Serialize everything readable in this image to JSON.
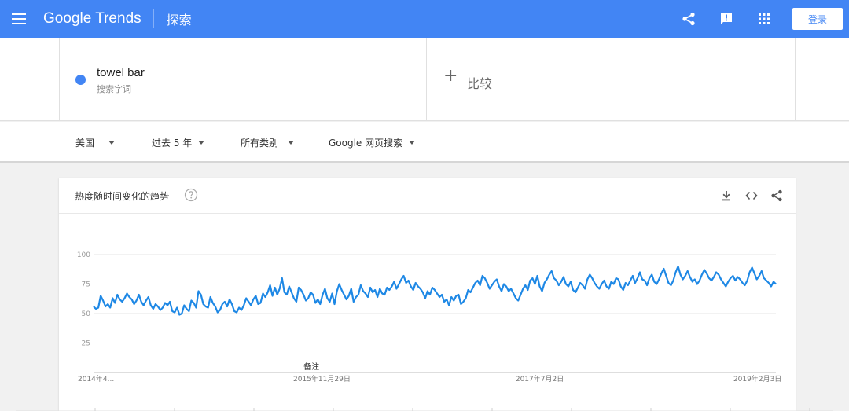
{
  "topbar": {
    "logo": "Google Trends",
    "page_title": "探索",
    "login_label": "登录",
    "icons": [
      "menu-icon",
      "share-icon",
      "feedback-icon",
      "apps-icon"
    ],
    "bg_color": "#4285f4"
  },
  "term": {
    "name": "towel bar",
    "type": "搜索字词",
    "dot_color": "#4285f4"
  },
  "compare": {
    "plus": "+",
    "label": "比较"
  },
  "filters": {
    "region": "美国",
    "time": "过去 5 年",
    "category": "所有类别",
    "property": "Google 网页搜索"
  },
  "card": {
    "title": "热度随时间变化的趋势",
    "icons": [
      "download-icon",
      "embed-icon",
      "share-icon",
      "help-icon"
    ]
  },
  "chart_data": {
    "type": "line",
    "title": "",
    "xlabel": "",
    "ylabel": "",
    "ylim": [
      0,
      100
    ],
    "yticks": [
      25,
      50,
      75,
      100
    ],
    "yticks_text": [
      "25",
      "50",
      "75",
      "100"
    ],
    "xticks": [
      {
        "label": "2014年4...",
        "x": 0
      },
      {
        "label": "2015年11月29日",
        "x": 87
      },
      {
        "label": "2017年7月2日",
        "x": 170
      },
      {
        "label": "2019年2月3日",
        "x": 253
      }
    ],
    "note_label": "备注",
    "note_x": 83,
    "series": [
      {
        "color": "#1e88e5",
        "values": [
          56,
          54,
          55,
          65,
          61,
          56,
          58,
          55,
          63,
          59,
          66,
          62,
          60,
          63,
          67,
          64,
          62,
          58,
          61,
          66,
          60,
          57,
          61,
          64,
          57,
          54,
          58,
          56,
          53,
          55,
          59,
          57,
          60,
          52,
          51,
          55,
          49,
          50,
          57,
          54,
          52,
          61,
          59,
          55,
          69,
          66,
          58,
          56,
          55,
          64,
          59,
          56,
          51,
          53,
          58,
          60,
          56,
          62,
          58,
          52,
          51,
          55,
          53,
          57,
          63,
          60,
          57,
          62,
          65,
          58,
          59,
          67,
          64,
          68,
          74,
          65,
          72,
          66,
          71,
          80,
          68,
          66,
          73,
          68,
          63,
          60,
          72,
          70,
          66,
          61,
          63,
          68,
          66,
          59,
          62,
          58,
          66,
          71,
          63,
          60,
          67,
          58,
          69,
          75,
          70,
          66,
          62,
          65,
          71,
          60,
          64,
          66,
          74,
          69,
          67,
          64,
          72,
          68,
          70,
          64,
          71,
          67,
          66,
          72,
          70,
          73,
          77,
          71,
          75,
          79,
          82,
          76,
          78,
          73,
          70,
          76,
          73,
          71,
          68,
          63,
          69,
          66,
          72,
          70,
          67,
          64,
          66,
          60,
          62,
          57,
          64,
          61,
          65,
          66,
          58,
          60,
          63,
          70,
          68,
          72,
          76,
          78,
          74,
          82,
          80,
          76,
          71,
          74,
          77,
          79,
          73,
          69,
          75,
          73,
          69,
          71,
          67,
          63,
          61,
          66,
          71,
          74,
          70,
          78,
          80,
          75,
          82,
          73,
          69,
          76,
          79,
          83,
          86,
          80,
          78,
          74,
          77,
          81,
          75,
          73,
          77,
          70,
          68,
          72,
          76,
          74,
          71,
          79,
          83,
          80,
          76,
          73,
          71,
          75,
          78,
          73,
          71,
          77,
          75,
          80,
          79,
          73,
          70,
          76,
          74,
          78,
          82,
          76,
          80,
          85,
          79,
          78,
          74,
          80,
          83,
          77,
          75,
          79,
          84,
          88,
          82,
          76,
          74,
          78,
          85,
          90,
          83,
          79,
          82,
          86,
          81,
          77,
          79,
          75,
          78,
          83,
          87,
          84,
          80,
          78,
          81,
          85,
          83,
          79,
          76,
          73,
          77,
          80,
          82,
          78,
          81,
          79,
          76,
          74,
          78,
          85,
          89,
          84,
          79,
          82,
          86,
          80,
          78,
          76,
          73,
          77,
          75
        ]
      }
    ],
    "grid": true
  }
}
